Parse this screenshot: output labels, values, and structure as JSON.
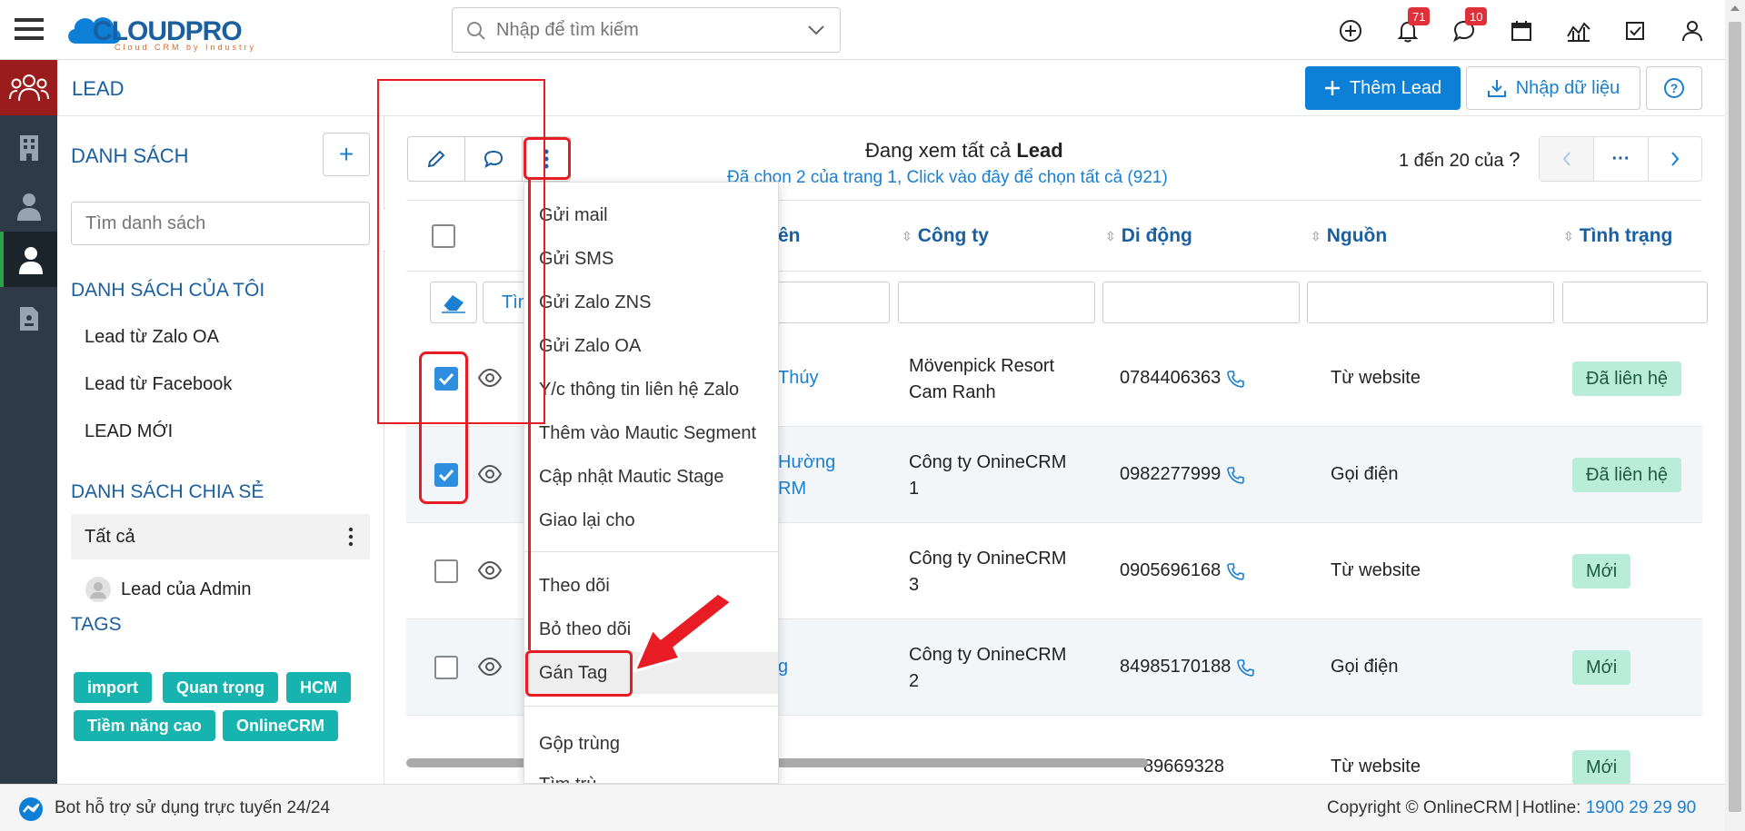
{
  "app": {
    "logo_text": "CLOUDPRO",
    "logo_tagline": "Cloud CRM by Industry"
  },
  "search": {
    "placeholder": "Nhập để tìm kiếm"
  },
  "top_icons": {
    "notifications_count": "71",
    "messages_count": "10"
  },
  "header": {
    "title": "LEAD",
    "add_label": "Thêm Lead",
    "import_label": "Nhập dữ liệu",
    "help_label": "?"
  },
  "sidebar": {
    "lists_title": "DANH SÁCH",
    "add_label": "+",
    "search_placeholder": "Tìm danh sách",
    "my_lists_title": "DANH SÁCH CỦA TÔI",
    "my_lists": [
      "Lead từ Zalo OA",
      "Lead từ Facebook",
      "LEAD MỚI"
    ],
    "shared_title": "DANH SÁCH CHIA SẺ",
    "shared_all": "Tất cả",
    "shared_admin": "Lead của Admin",
    "tags_title": "TAGS",
    "tags": [
      "import",
      "Quan trọng",
      "HCM",
      "Tiềm năng cao",
      "OnlineCRM"
    ]
  },
  "toolbar": {
    "viewing_prefix": "Đang xem tất cả",
    "viewing_module": "Lead",
    "selected_text": "Đã chọn 2 của trang 1, Click vào đây để chọn tất cả (921)",
    "pagination_text": "1 đến 20 của",
    "pagination_q": "?",
    "more_label": "···"
  },
  "table": {
    "columns": [
      "ên",
      "Công ty",
      "Di động",
      "Nguồn",
      "Tình trạng"
    ],
    "filter_button_label": "Tìm",
    "rows": [
      {
        "name": "Thúy",
        "name2": "",
        "company": "Mövenpick Resort",
        "company2": "Cam Ranh",
        "phone": "0784406363",
        "source": "Từ website",
        "status": "Đã liên hệ",
        "checked": true
      },
      {
        "name": "Hường",
        "name2": "RM",
        "company": "Công ty OnineCRM",
        "company2": "1",
        "phone": "0982277999",
        "source": "Gọi điện",
        "status": "Đã liên hệ",
        "checked": true
      },
      {
        "name": "",
        "name2": "",
        "company": "Công ty OnineCRM",
        "company2": "3",
        "phone": "0905696168",
        "source": "Từ website",
        "status": "Mới",
        "checked": false
      },
      {
        "name": "g",
        "name2": "",
        "company": "Công ty OnineCRM",
        "company2": "2",
        "phone": "84985170188",
        "source": "Gọi điện",
        "status": "Mới",
        "checked": false
      },
      {
        "name": "",
        "name2": "",
        "company": "",
        "company2": "",
        "phone": "89669328",
        "source": "Từ website",
        "status": "Mới",
        "checked": false
      }
    ]
  },
  "menu": {
    "group1": [
      "Gửi mail",
      "Gửi SMS",
      "Gửi Zalo ZNS",
      "Gửi Zalo OA",
      "Y/c thông tin liên hệ Zalo",
      "Thêm vào Mautic Segment",
      "Cập nhật Mautic Stage",
      "Giao lại cho"
    ],
    "group2": [
      "Theo dõi",
      "Bỏ theo dõi",
      "Gán Tag"
    ],
    "group3": [
      "Gộp trùng",
      "Tìm trù"
    ]
  },
  "footer": {
    "bot_text": "Bot hỗ trợ sử dụng trực tuyến 24/24",
    "copyright": "Copyright © OnlineCRM",
    "sep": "|",
    "hotline_label": "Hotline:",
    "hotline_number": "1900 29 29 90"
  },
  "colors": {
    "brand": "#1a5fa0",
    "primary_button": "#0e7fd6",
    "tag": "#17b3ae",
    "status_bg": "#b9ecd9",
    "highlight": "#e81c24",
    "rail": "#2e3a46",
    "rail_active": "#9b1c1c"
  }
}
